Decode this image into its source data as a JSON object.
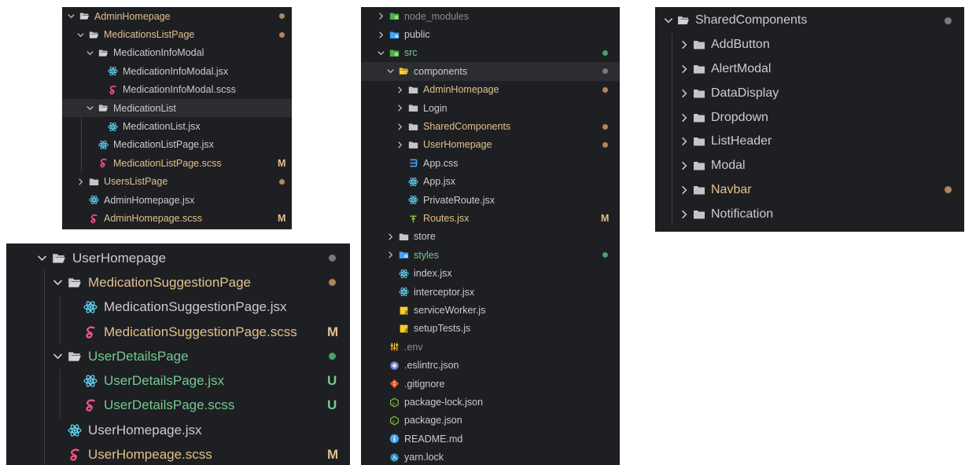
{
  "colors": {
    "default": "#cccccc",
    "modified": "#e2c08d",
    "untracked": "#73c991",
    "ignored": "#8c8c8c",
    "dot_default": "#7a7a7a",
    "dot_modified": "#b0875a",
    "dot_untracked": "#4f9e69",
    "react": "#61dafb",
    "sass": "#f55385",
    "css": "#42a5f5",
    "js": "#ffca28"
  },
  "panels": {
    "admin": {
      "items": [
        {
          "label": "AdminHomepage",
          "kind": "folder",
          "open": true,
          "status": "modified",
          "dot": true
        },
        {
          "label": "MedicationsListPage",
          "kind": "folder",
          "open": true,
          "status": "modified",
          "dot": true
        },
        {
          "label": "MedicationInfoModal",
          "kind": "folder",
          "open": true,
          "status": "default"
        },
        {
          "label": "MedicationInfoModal.jsx",
          "kind": "react",
          "status": "default"
        },
        {
          "label": "MedicationInfoModal.scss",
          "kind": "sass",
          "status": "default"
        },
        {
          "label": "MedicationList",
          "kind": "folder",
          "open": true,
          "status": "default",
          "selected": true
        },
        {
          "label": "MedicationList.jsx",
          "kind": "react",
          "status": "default"
        },
        {
          "label": "MedicationListPage.jsx",
          "kind": "react",
          "status": "default"
        },
        {
          "label": "MedicationListPage.scss",
          "kind": "sass",
          "status": "modified",
          "badge": "M"
        },
        {
          "label": "UsersListPage",
          "kind": "folder",
          "open": false,
          "status": "modified",
          "dot": true
        },
        {
          "label": "AdminHomepage.jsx",
          "kind": "react",
          "status": "default"
        },
        {
          "label": "AdminHomepage.scss",
          "kind": "sass",
          "status": "modified",
          "badge": "M"
        }
      ]
    },
    "user": {
      "items": [
        {
          "label": "UserHomepage",
          "kind": "folder",
          "open": true,
          "status": "default",
          "dot": true
        },
        {
          "label": "MedicationSuggestionPage",
          "kind": "folder",
          "open": true,
          "status": "modified",
          "dot": true
        },
        {
          "label": "MedicationSuggestionPage.jsx",
          "kind": "react",
          "status": "default"
        },
        {
          "label": "MedicationSuggestionPage.scss",
          "kind": "sass",
          "status": "modified",
          "badge": "M"
        },
        {
          "label": "UserDetailsPage",
          "kind": "folder",
          "open": true,
          "status": "untracked",
          "dot": true
        },
        {
          "label": "UserDetailsPage.jsx",
          "kind": "react",
          "status": "untracked",
          "badge": "U"
        },
        {
          "label": "UserDetailsPage.scss",
          "kind": "sass",
          "status": "untracked",
          "badge": "U"
        },
        {
          "label": "UserHomepage.jsx",
          "kind": "react",
          "status": "default"
        },
        {
          "label": "UserHompeage.scss",
          "kind": "sass",
          "status": "modified",
          "badge": "M"
        }
      ]
    },
    "main": {
      "items": [
        {
          "label": "node_modules",
          "kind": "folder-green",
          "open": false,
          "status": "ignored"
        },
        {
          "label": "public",
          "kind": "folder-blue",
          "open": false,
          "status": "default"
        },
        {
          "label": "src",
          "kind": "folder-green",
          "open": true,
          "status": "untracked",
          "dot": true
        },
        {
          "label": "components",
          "kind": "folder-yellow",
          "open": true,
          "status": "default",
          "dot": true,
          "selected": true
        },
        {
          "label": "AdminHomepage",
          "kind": "folder",
          "open": false,
          "status": "modified",
          "dot": true
        },
        {
          "label": "Login",
          "kind": "folder",
          "open": false,
          "status": "default"
        },
        {
          "label": "SharedComponents",
          "kind": "folder",
          "open": false,
          "status": "modified",
          "dot": true
        },
        {
          "label": "UserHomepage",
          "kind": "folder",
          "open": false,
          "status": "modified",
          "dot": true
        },
        {
          "label": "App.css",
          "kind": "css",
          "status": "default"
        },
        {
          "label": "App.jsx",
          "kind": "react",
          "status": "default"
        },
        {
          "label": "PrivateRoute.jsx",
          "kind": "react",
          "status": "default"
        },
        {
          "label": "Routes.jsx",
          "kind": "routes",
          "status": "modified",
          "badge": "M"
        },
        {
          "label": "store",
          "kind": "folder",
          "open": false,
          "status": "default"
        },
        {
          "label": "styles",
          "kind": "folder-blue",
          "open": false,
          "status": "untracked",
          "dot": true
        },
        {
          "label": "index.jsx",
          "kind": "react",
          "status": "default"
        },
        {
          "label": "interceptor.jsx",
          "kind": "react",
          "status": "default"
        },
        {
          "label": "serviceWorker.js",
          "kind": "js",
          "status": "default"
        },
        {
          "label": "setupTests.js",
          "kind": "js",
          "status": "default"
        },
        {
          "label": ".env",
          "kind": "env",
          "status": "ignored"
        },
        {
          "label": ".eslintrc.json",
          "kind": "eslint",
          "status": "default"
        },
        {
          "label": ".gitignore",
          "kind": "git",
          "status": "default"
        },
        {
          "label": "package-lock.json",
          "kind": "npm",
          "status": "default"
        },
        {
          "label": "package.json",
          "kind": "npm",
          "status": "default"
        },
        {
          "label": "README.md",
          "kind": "info",
          "status": "default"
        },
        {
          "label": "yarn.lock",
          "kind": "yarn",
          "status": "default"
        }
      ]
    },
    "shared": {
      "items": [
        {
          "label": "SharedComponents",
          "kind": "folder",
          "open": true,
          "status": "default",
          "dot": true
        },
        {
          "label": "AddButton",
          "kind": "folder",
          "open": false,
          "status": "default"
        },
        {
          "label": "AlertModal",
          "kind": "folder",
          "open": false,
          "status": "default"
        },
        {
          "label": "DataDisplay",
          "kind": "folder",
          "open": false,
          "status": "default"
        },
        {
          "label": "Dropdown",
          "kind": "folder",
          "open": false,
          "status": "default"
        },
        {
          "label": "ListHeader",
          "kind": "folder",
          "open": false,
          "status": "default"
        },
        {
          "label": "Modal",
          "kind": "folder",
          "open": false,
          "status": "default"
        },
        {
          "label": "Navbar",
          "kind": "folder",
          "open": false,
          "status": "modified",
          "dot": true
        },
        {
          "label": "Notification",
          "kind": "folder",
          "open": false,
          "status": "default"
        }
      ]
    }
  }
}
